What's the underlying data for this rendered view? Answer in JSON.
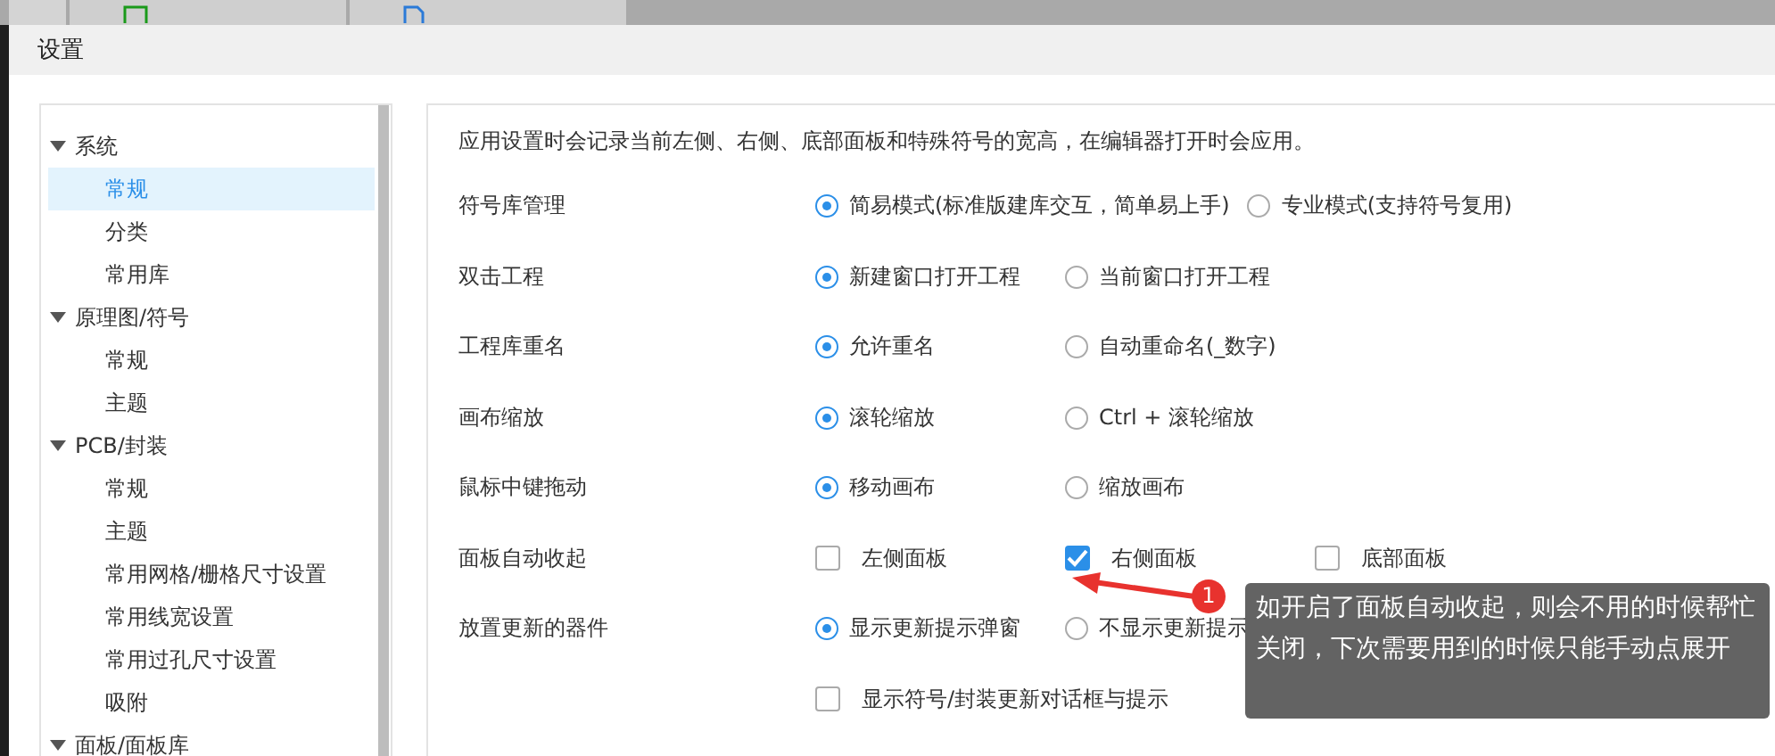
{
  "app_tabs": [
    {
      "kind": "board"
    },
    {
      "kind": "schematic"
    }
  ],
  "window": {
    "title": "设置"
  },
  "sidebar": {
    "items": [
      {
        "label": "系统",
        "expanded": true,
        "selected": false,
        "children": [
          {
            "label": "常规",
            "selected": true
          },
          {
            "label": "分类",
            "selected": false
          },
          {
            "label": "常用库",
            "selected": false
          }
        ]
      },
      {
        "label": "原理图/符号",
        "expanded": true,
        "selected": false,
        "children": [
          {
            "label": "常规",
            "selected": false
          },
          {
            "label": "主题",
            "selected": false
          }
        ]
      },
      {
        "label": "PCB/封装",
        "expanded": true,
        "selected": false,
        "children": [
          {
            "label": "常规",
            "selected": false
          },
          {
            "label": "主题",
            "selected": false
          },
          {
            "label": "常用网格/栅格尺寸设置",
            "selected": false
          },
          {
            "label": "常用线宽设置",
            "selected": false
          },
          {
            "label": "常用过孔尺寸设置",
            "selected": false
          },
          {
            "label": "吸附",
            "selected": false
          }
        ]
      },
      {
        "label": "面板/面板库",
        "expanded": true,
        "selected": false
      }
    ]
  },
  "description": "应用设置时会记录当前左侧、右侧、底部面板和特殊符号的宽高，在编辑器打开时会应用。",
  "settings": [
    {
      "label": "符号库管理",
      "kind": "radio",
      "options": [
        {
          "label": "简易模式(标准版建库交互，简单易上手)",
          "selected": true
        },
        {
          "label": "专业模式(支持符号复用)",
          "selected": false
        }
      ]
    },
    {
      "label": "双击工程",
      "kind": "radio",
      "options": [
        {
          "label": "新建窗口打开工程",
          "selected": true
        },
        {
          "label": "当前窗口打开工程",
          "selected": false
        }
      ]
    },
    {
      "label": "工程库重名",
      "kind": "radio",
      "options": [
        {
          "label": "允许重名",
          "selected": true
        },
        {
          "label": "自动重命名(_数字)",
          "selected": false
        }
      ]
    },
    {
      "label": "画布缩放",
      "kind": "radio",
      "options": [
        {
          "label": "滚轮缩放",
          "selected": true
        },
        {
          "label": "Ctrl + 滚轮缩放",
          "selected": false
        }
      ]
    },
    {
      "label": "鼠标中键拖动",
      "kind": "radio",
      "options": [
        {
          "label": "移动画布",
          "selected": true
        },
        {
          "label": "缩放画布",
          "selected": false
        }
      ]
    },
    {
      "label": "面板自动收起",
      "kind": "checkbox",
      "options": [
        {
          "label": "左侧面板",
          "checked": false
        },
        {
          "label": "右侧面板",
          "checked": true
        },
        {
          "label": "底部面板",
          "checked": false
        }
      ]
    },
    {
      "label": "放置更新的器件",
      "kind": "radio",
      "options": [
        {
          "label": "显示更新提示弹窗",
          "selected": true
        },
        {
          "label": "不显示更新提示",
          "selected": false
        }
      ]
    },
    {
      "kind": "checkbox",
      "options": [
        {
          "label": "显示符号/封装更新对话框与提示",
          "checked": false
        }
      ]
    }
  ],
  "annotation": {
    "badge": "1",
    "text": "如开启了面板自动收起，则会不用的时候帮忙关闭，下次需要用到的时候只能手动点展开"
  }
}
